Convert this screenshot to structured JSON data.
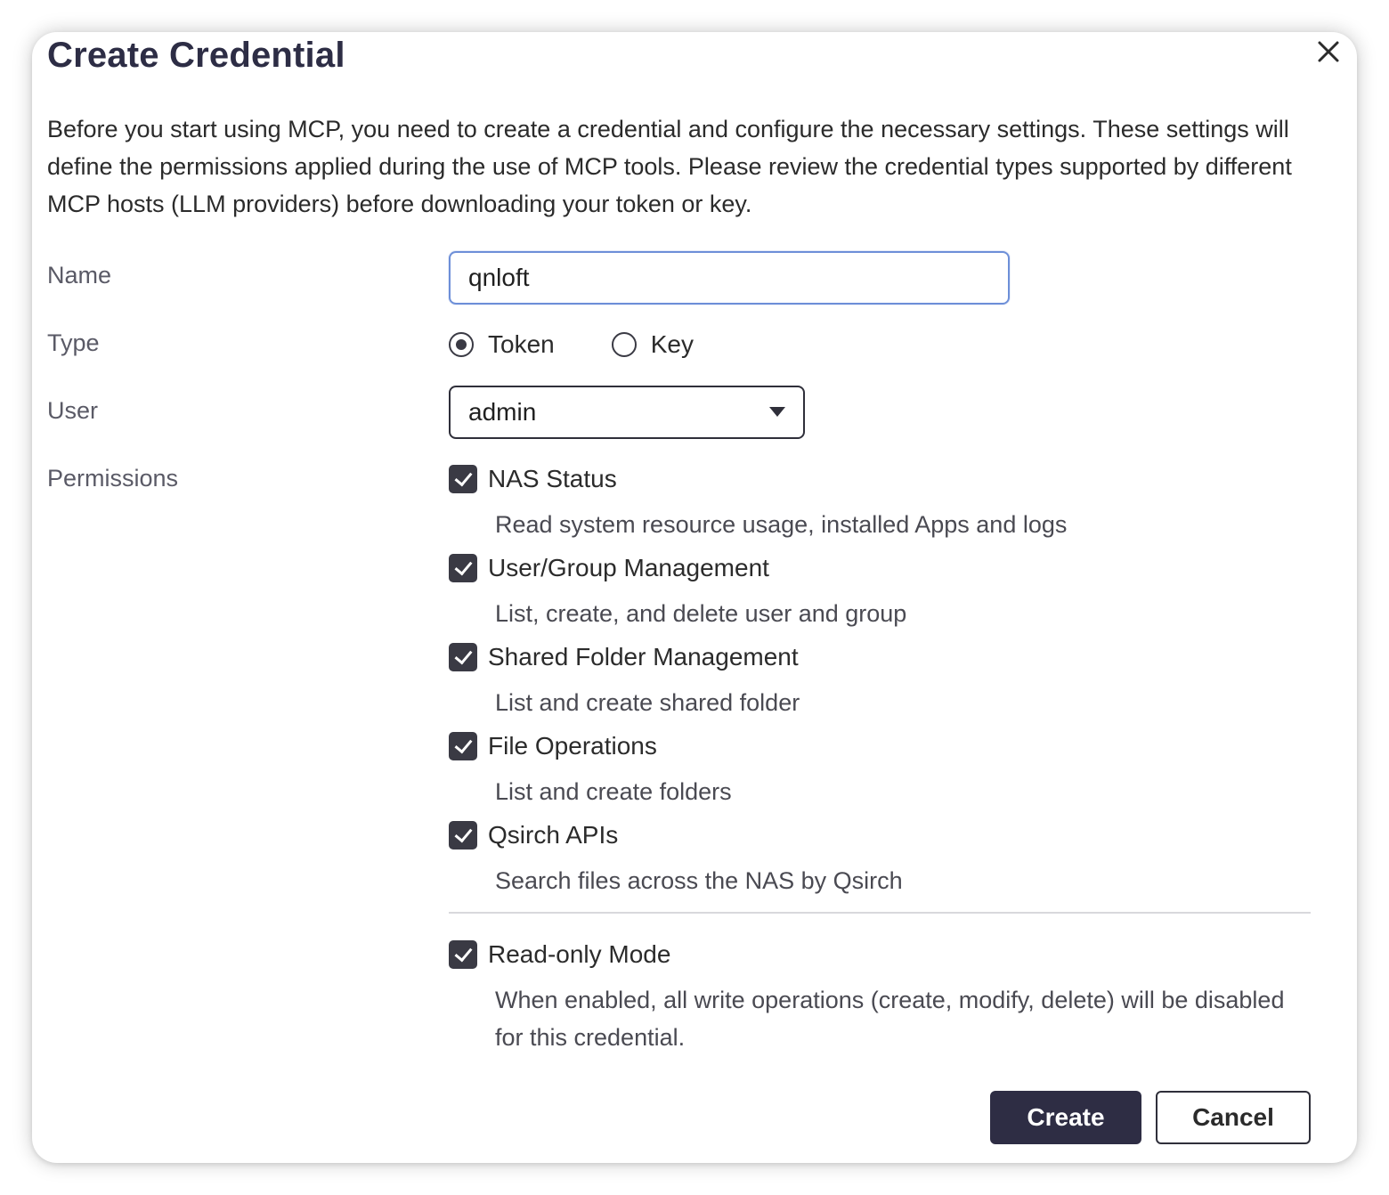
{
  "dialog": {
    "title": "Create Credential",
    "intro": "Before you start using MCP, you need to create a credential and configure the necessary settings. These settings will define the permissions applied during the use of MCP tools. Please review the credential types supported by different MCP hosts (LLM providers) before downloading your token or key."
  },
  "form": {
    "name_label": "Name",
    "name_value": "qnloft",
    "type_label": "Type",
    "type_options": [
      {
        "label": "Token",
        "selected": true
      },
      {
        "label": "Key",
        "selected": false
      }
    ],
    "user_label": "User",
    "user_value": "admin",
    "permissions_label": "Permissions",
    "permissions": [
      {
        "label": "NAS Status",
        "desc": "Read system resource usage, installed Apps and logs",
        "checked": true
      },
      {
        "label": "User/Group Management",
        "desc": "List, create, and delete user and group",
        "checked": true
      },
      {
        "label": "Shared Folder Management",
        "desc": "List and create shared folder",
        "checked": true
      },
      {
        "label": "File Operations",
        "desc": "List and create folders",
        "checked": true
      },
      {
        "label": "Qsirch APIs",
        "desc": "Search files across the NAS by Qsirch",
        "checked": true
      }
    ],
    "readonly": {
      "label": "Read-only Mode",
      "desc": "When enabled, all write operations (create, modify, delete) will be disabled for this credential.",
      "checked": true
    }
  },
  "buttons": {
    "create": "Create",
    "cancel": "Cancel"
  },
  "colors": {
    "primary": "#2e2d44",
    "focus_border": "#6d8fd8",
    "checkbox": "#3a3a44"
  }
}
